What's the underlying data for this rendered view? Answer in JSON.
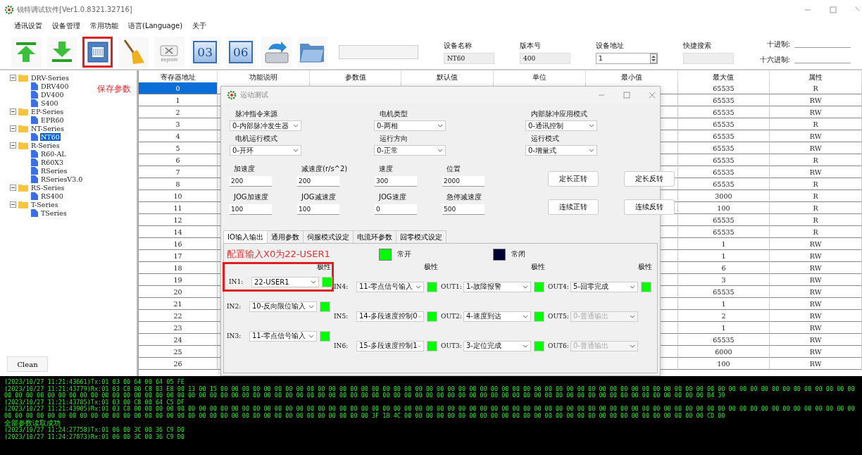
{
  "window": {
    "title": "锐特调试软件[Ver1.0.8321.32716]"
  },
  "menu": [
    "通讯设置",
    "设备管理",
    "常用功能",
    "语言(Language)",
    "关于"
  ],
  "toolbar": [
    {
      "kind": "upload",
      "highlighted": false
    },
    {
      "kind": "download",
      "highlighted": false
    },
    {
      "kind": "chip",
      "highlighted": true
    },
    {
      "kind": "broom",
      "highlighted": false
    },
    {
      "kind": "eeprom",
      "label": "eeprom",
      "highlighted": false
    },
    {
      "kind": "code",
      "label": "03",
      "highlighted": false
    },
    {
      "kind": "code",
      "label": "06",
      "highlighted": false
    },
    {
      "kind": "disk",
      "highlighted": false
    },
    {
      "kind": "folder",
      "highlighted": false
    }
  ],
  "device": [
    {
      "label": "设备名称",
      "value": "NT60",
      "kind": "text"
    },
    {
      "label": "版本号",
      "value": "400",
      "kind": "text"
    },
    {
      "label": "设备地址",
      "value": "1",
      "kind": "spin"
    },
    {
      "label": "快捷搜索",
      "kind": "text"
    }
  ],
  "conversion": [
    {
      "label": "十进制:"
    },
    {
      "label": "十六进制:"
    }
  ],
  "tree": [
    {
      "label": "DRV-Series",
      "expanded": true,
      "children": [
        {
          "label": "DRV400",
          "selected": false
        },
        {
          "label": "DV400",
          "selected": false
        },
        {
          "label": "S400",
          "selected": false
        }
      ]
    },
    {
      "label": "EP-Series",
      "expanded": true,
      "children": [
        {
          "label": "EPR60",
          "selected": false
        }
      ]
    },
    {
      "label": "NT-Series",
      "expanded": true,
      "children": [
        {
          "label": "NT60",
          "selected": true
        }
      ]
    },
    {
      "label": "R-Series",
      "expanded": true,
      "children": [
        {
          "label": "R60-AL",
          "selected": false
        },
        {
          "label": "R60X3",
          "selected": false
        },
        {
          "label": "RSeries",
          "selected": false
        },
        {
          "label": "RSeriesV3.0",
          "selected": false
        }
      ]
    },
    {
      "label": "RS-Series",
      "expanded": true,
      "children": [
        {
          "label": "RS400",
          "selected": false
        }
      ]
    },
    {
      "label": "T-Series",
      "expanded": true,
      "children": [
        {
          "label": "TSeries",
          "selected": false
        }
      ]
    }
  ],
  "clean_button": "Clean",
  "annotation_save": "保存参数",
  "table": {
    "columns": [
      "寄存器地址",
      "功能说明",
      "参数值",
      "默认值",
      "单位",
      "最小值",
      "最大值",
      "属性"
    ],
    "rows": [
      {
        "address": "0",
        "max": "65535",
        "attr": "R",
        "selected": true
      },
      {
        "address": "1",
        "max": "65535",
        "attr": "RW",
        "selected": false
      },
      {
        "address": "2",
        "max": "65535",
        "attr": "RW",
        "selected": false
      },
      {
        "address": "3",
        "max": "65535",
        "attr": "R",
        "selected": false
      },
      {
        "address": "4",
        "max": "65535",
        "attr": "RW",
        "selected": false
      },
      {
        "address": "5",
        "max": "65535",
        "attr": "RW",
        "selected": false
      },
      {
        "address": "6",
        "max": "65535",
        "attr": "R",
        "selected": false
      },
      {
        "address": "7",
        "max": "65535",
        "attr": "RW",
        "selected": false
      },
      {
        "address": "8",
        "max": "65535",
        "attr": "R",
        "selected": false
      },
      {
        "address": "10",
        "max": "3000",
        "attr": "R",
        "selected": false
      },
      {
        "address": "11",
        "max": "100",
        "attr": "R",
        "selected": false
      },
      {
        "address": "12",
        "max": "65535",
        "attr": "R",
        "selected": false
      },
      {
        "address": "14",
        "max": "65535",
        "attr": "R",
        "selected": false
      },
      {
        "address": "16",
        "max": "1",
        "attr": "RW",
        "selected": false
      },
      {
        "address": "17",
        "max": "1",
        "attr": "RW",
        "selected": false
      },
      {
        "address": "18",
        "max": "6",
        "attr": "RW",
        "selected": false
      },
      {
        "address": "19",
        "max": "3",
        "attr": "RW",
        "selected": false
      },
      {
        "address": "20",
        "max": "65535",
        "attr": "RW",
        "selected": false
      },
      {
        "address": "21",
        "max": "1",
        "attr": "RW",
        "selected": false
      },
      {
        "address": "22",
        "max": "2",
        "attr": "RW",
        "selected": false
      },
      {
        "address": "23",
        "max": "1",
        "attr": "RW",
        "selected": false
      },
      {
        "address": "24",
        "max": "65535",
        "attr": "RW",
        "selected": false
      },
      {
        "address": "25",
        "max": "6000",
        "attr": "RW",
        "selected": false
      },
      {
        "address": "26",
        "max": "100",
        "attr": "RW",
        "selected": false
      }
    ]
  },
  "dialog": {
    "title": "运动测试",
    "selects": [
      {
        "label": "脉冲指令来源",
        "value": "0-内部脉冲发生器"
      },
      {
        "label": "电机类型",
        "value": "0-两相"
      },
      {
        "label": "内部脉冲应用模式",
        "value": "0-通讯控制"
      },
      {
        "label": "电机运行模式",
        "value": "0-开环"
      },
      {
        "label": "运行方向",
        "value": "0-正常"
      },
      {
        "label": "运行模式",
        "value": "0-增量式"
      }
    ],
    "number_rows": [
      {
        "fields": [
          {
            "label": "加速度",
            "value": "200"
          },
          {
            "label": "减速度(r/s^2)",
            "value": "200"
          },
          {
            "label": "速度",
            "value": "300"
          },
          {
            "label": "位置",
            "value": "2000"
          }
        ],
        "buttons": [
          "定长正转",
          "定长反转"
        ]
      },
      {
        "fields": [
          {
            "label": "JOG加速度",
            "value": "100"
          },
          {
            "label": "JOG减速度",
            "value": "100"
          },
          {
            "label": "JOG速度",
            "value": "0"
          },
          {
            "label": "急停减速度",
            "value": "500"
          }
        ],
        "buttons": [
          "连续正转",
          "连续反转"
        ]
      }
    ],
    "tabs": [
      {
        "label": "IO输入输出",
        "selected": true
      },
      {
        "label": "通用参数",
        "selected": false
      },
      {
        "label": "伺服模式设定",
        "selected": false
      },
      {
        "label": "电流环参数",
        "selected": false
      },
      {
        "label": "回零模式设定",
        "selected": false
      }
    ],
    "annotation": "配置输入X0为22-USER1",
    "legend": [
      {
        "label": "常开",
        "color": "#00ff00"
      },
      {
        "label": "常闭",
        "color": "#000033"
      }
    ],
    "io_columns": [
      {
        "polarity_label": "极性",
        "items": [
          {
            "label": "IN1:",
            "value": "22-USER1",
            "on": true,
            "disabled": false,
            "highlighted": true
          },
          {
            "label": "IN2:",
            "value": "10-反向限位输入",
            "on": true,
            "disabled": false,
            "highlighted": false
          },
          {
            "label": "IN3:",
            "value": "11-零点信号输入",
            "on": true,
            "disabled": false,
            "highlighted": false
          }
        ]
      },
      {
        "polarity_label": "极性",
        "items": [
          {
            "label": "IN4:",
            "value": "11-零点信号输入",
            "on": true,
            "disabled": false,
            "highlighted": false
          },
          {
            "label": "IN5:",
            "value": "14-多段速度控制0",
            "on": true,
            "disabled": false,
            "highlighted": false
          },
          {
            "label": "IN6:",
            "value": "15-多段速度控制1",
            "on": true,
            "disabled": false,
            "highlighted": false
          }
        ]
      },
      {
        "polarity_label": "极性",
        "items": [
          {
            "label": "OUT1:",
            "value": "1-故障报警",
            "on": true,
            "disabled": false,
            "highlighted": false
          },
          {
            "label": "OUT2:",
            "value": "4-速度到达",
            "on": true,
            "disabled": false,
            "highlighted": false
          },
          {
            "label": "OUT3:",
            "value": "3-定位完成",
            "on": true,
            "disabled": false,
            "highlighted": false
          }
        ]
      },
      {
        "polarity_label": "极性",
        "items": [
          {
            "label": "OUT4:",
            "value": "5-回零完成",
            "on": true,
            "disabled": false,
            "highlighted": false
          },
          {
            "label": "OUT5:",
            "value": "0-普通输出",
            "disabled": true,
            "highlighted": false
          },
          {
            "label": "OUT6:",
            "value": "0-普通输出",
            "disabled": true,
            "highlighted": false
          }
        ]
      }
    ]
  },
  "log": [
    "(2023/10/27 11:21:43661)Tx:01 03 00 64 00 64 05 FE",
    "(2023/10/27 11:21:43779)Rx:01 03 C8 00 C8 03 E8 00 13 00 15 00 00 00 00 00 00 00 00 00 00 00 00 00 00 00 00 00 00 00 00 00 00 00 00 00 00 00 00 00 00 00 00 00 00 00 00 00 00 00 00 00 00 00 00 00 00 00 00 00 00 00 00 00 00 00 00 00 00 00 00 00 00 00 00 00 00 00 00 00 00 00 00 00 00 00 00 00 00 00 00 00 00 00 00 00 00 00 00 00 00 00 00 00 00 00 00 00 00 00 00 00 00 00 00 00 00 00 00 00 00 00 00 00 00 00 00 00 00 00 00 00 00 00 00 B4 39",
    "(2023/10/27 11:21:43785)Tx:01 03 00 C8 00 64 C5 DF",
    "(2023/10/27 11:21:43905)Rx:01 03 C8 00 00 00 00 00 00 00 00 00 00 00 00 00 00 00 00 00 00 00 00 00 00 00 00 00 00 00 00 00 00 00 00 00 00 00 00 00 00 00 00 00 00 00 00 00 00 00 00 00 00 00 00 00 00 00 00 00 00 00 00 00 00 00 00 00 00 00 00 00 00 00 00 00 00 00 00 00 00 00 00 00 00 00 00 00 00 00 00 00 00 00 00 00 00 00 00 00 00 00 00 00 3F 1B 4C 00 00 00 00 00 00 00 00 00 00 00 00 00 00 00 00 00 00 00 00 00 00 00 00 00 00 00 00 CD 00",
    "全部参数读取成功",
    "(2023/10/27 11:24:27758)Tx:01 06 00 3C 00 36 C9 D0",
    "(2023/10/27 11:24:27873)Rx:01 06 00 3C 00 36 C9 D0"
  ]
}
